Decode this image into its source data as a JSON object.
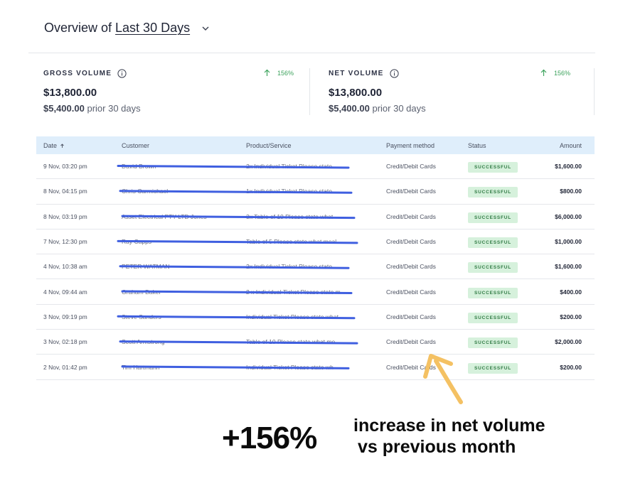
{
  "header": {
    "prefix": "Overview of",
    "period": "Last 30 Days"
  },
  "metrics": [
    {
      "label": "GROSS VOLUME",
      "change": "156%",
      "value": "$13,800.00",
      "prior_value": "$5,400.00",
      "prior_text": "prior 30 days"
    },
    {
      "label": "NET VOLUME",
      "change": "156%",
      "value": "$13,800.00",
      "prior_value": "$5,400.00",
      "prior_text": "prior 30 days"
    }
  ],
  "table": {
    "columns": [
      "Date",
      "Customer",
      "Product/Service",
      "Payment method",
      "Status",
      "Amount"
    ],
    "rows": [
      {
        "date": "9 Nov, 03:20 pm",
        "customer": "David Brown",
        "product": "2x Individual Ticket Please state",
        "payment": "Credit/Debit Cards",
        "status": "SUCCESSFUL",
        "amount": "$1,600.00"
      },
      {
        "date": "8 Nov, 04:15 pm",
        "customer": "Chris Carmichael",
        "product": "1x Individual Ticket Please state",
        "payment": "Credit/Debit Cards",
        "status": "SUCCESSFUL",
        "amount": "$800.00"
      },
      {
        "date": "8 Nov, 03:19 pm",
        "customer": "Asset Electrical PTY LTD Jones",
        "product": "3x Table of 10 Please state what",
        "payment": "Credit/Debit Cards",
        "status": "SUCCESSFUL",
        "amount": "$6,000.00"
      },
      {
        "date": "7 Nov, 12:30 pm",
        "customer": "Ray Capps",
        "product": "Table of 5 Please state what meal",
        "payment": "Credit/Debit Cards",
        "status": "SUCCESSFUL",
        "amount": "$1,000.00"
      },
      {
        "date": "4 Nov, 10:38 am",
        "customer": "PETER WATMAN",
        "product": "2x Individual Ticket Please state",
        "payment": "Credit/Debit Cards",
        "status": "SUCCESSFUL",
        "amount": "$1,600.00"
      },
      {
        "date": "4 Nov, 09:44 am",
        "customer": "Graham Baker",
        "product": "2 x Individual Ticket Please state m",
        "payment": "Credit/Debit Cards",
        "status": "SUCCESSFUL",
        "amount": "$400.00"
      },
      {
        "date": "3 Nov, 09:19 pm",
        "customer": "Steve Sanders",
        "product": "Individual Ticket Please state what",
        "payment": "Credit/Debit Cards",
        "status": "SUCCESSFUL",
        "amount": "$200.00"
      },
      {
        "date": "3 Nov, 02:18 pm",
        "customer": "Scott Armstrong",
        "product": "Table of 10 Please state what me",
        "payment": "Credit/Debit Cards",
        "status": "SUCCESSFUL",
        "amount": "$2,000.00"
      },
      {
        "date": "2 Nov, 01:42 pm",
        "customer": "Tim Hartmann",
        "product": "Individual Ticket Please state wh",
        "payment": "Credit/Debit Cards",
        "status": "SUCCESSFUL",
        "amount": "$200.00"
      }
    ]
  },
  "annotation": {
    "percent": "+156%",
    "line1": "increase in net volume",
    "line2": "vs previous month"
  },
  "colors": {
    "accent_green": "#3da35d",
    "header_bg": "#dfeefb",
    "strike": "#3f5fe0",
    "arrow": "#f4c163"
  }
}
